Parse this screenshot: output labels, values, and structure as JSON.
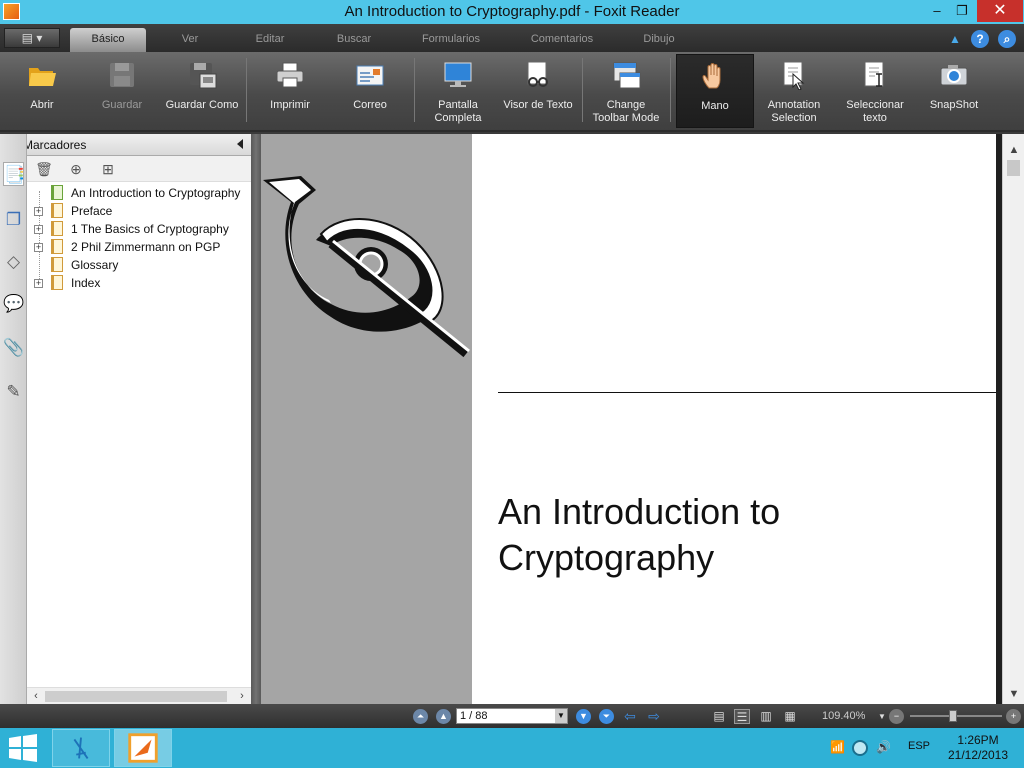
{
  "window": {
    "title": "An Introduction to Cryptography.pdf - Foxit Reader",
    "controls": {
      "minimize": "–",
      "restore": "❐",
      "close": "✕"
    }
  },
  "ribbon_tabs": [
    "Básico",
    "Ver",
    "Editar",
    "Buscar",
    "Formularios",
    "Comentarios",
    "Dibujo"
  ],
  "active_tab": "Básico",
  "ribbon_buttons": [
    {
      "label": "Abrir",
      "icon": "open-folder-icon",
      "state": "enabled"
    },
    {
      "label": "Guardar",
      "icon": "save-icon",
      "state": "disabled"
    },
    {
      "label": "Guardar Como",
      "icon": "save-as-icon",
      "state": "enabled"
    },
    {
      "label": "Imprimir",
      "icon": "print-icon",
      "state": "enabled"
    },
    {
      "label": "Correo",
      "icon": "mail-icon",
      "state": "enabled"
    },
    {
      "label": "Pantalla Completa",
      "icon": "full-screen-icon",
      "state": "enabled"
    },
    {
      "label": "Visor de Texto",
      "icon": "text-viewer-icon",
      "state": "enabled"
    },
    {
      "label": "Change Toolbar Mode",
      "icon": "toolbar-mode-icon",
      "state": "enabled"
    },
    {
      "label": "Mano",
      "icon": "hand-icon",
      "state": "active"
    },
    {
      "label": "Annotation Selection",
      "icon": "annotation-select-icon",
      "state": "enabled"
    },
    {
      "label": "Seleccionar texto",
      "icon": "select-text-icon",
      "state": "enabled"
    },
    {
      "label": "SnapShot",
      "icon": "camera-icon",
      "state": "enabled"
    }
  ],
  "bookmarks_panel": {
    "title": "Marcadores",
    "items": [
      {
        "label": "An Introduction to Cryptography",
        "expandable": false
      },
      {
        "label": "Preface",
        "expandable": true
      },
      {
        "label": "1  The Basics of Cryptography",
        "expandable": true
      },
      {
        "label": "2  Phil Zimmermann on PGP",
        "expandable": true
      },
      {
        "label": "Glossary",
        "expandable": false
      },
      {
        "label": "Index",
        "expandable": true
      }
    ]
  },
  "document": {
    "title": "An Introduction to Cryptography"
  },
  "statusbar": {
    "page_value": "1 / 88",
    "zoom": "109.40%",
    "zoom_level_fraction": 0.47
  },
  "taskbar": {
    "language": "ESP",
    "time": "1:26PM",
    "date": "21/12/2013"
  },
  "colors": {
    "titlebar": "#4fc6e8",
    "taskbar": "#2fb1d6",
    "close_button": "#c7302b"
  }
}
